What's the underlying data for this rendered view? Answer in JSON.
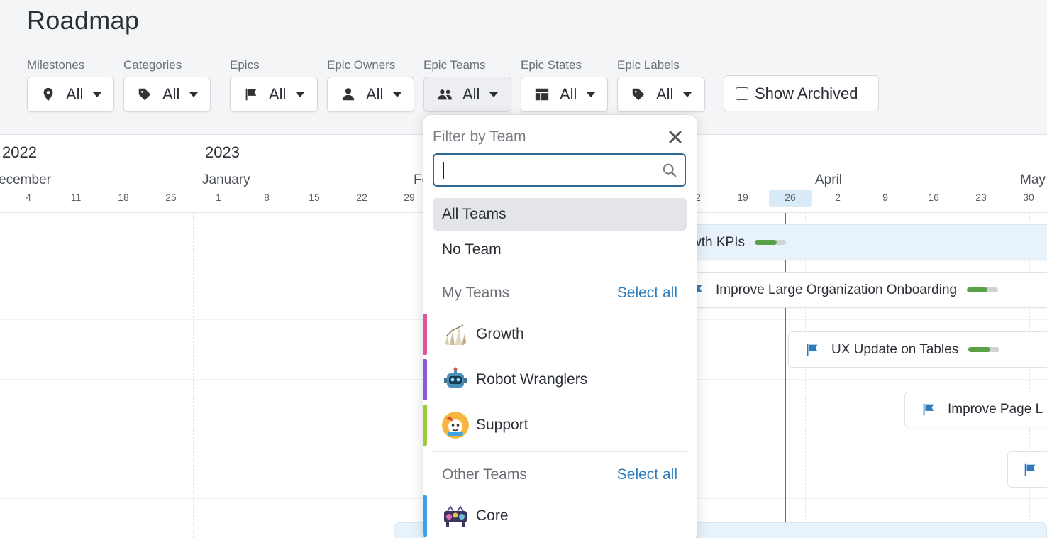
{
  "page": {
    "title": "Roadmap"
  },
  "filters": [
    {
      "label": "Milestones",
      "value": "All",
      "icon": "map-pin-icon"
    },
    {
      "label": "Categories",
      "value": "All",
      "icon": "tag-icon"
    },
    {
      "label": "Epics",
      "value": "All",
      "icon": "flag-icon"
    },
    {
      "label": "Epic Owners",
      "value": "All",
      "icon": "user-icon"
    },
    {
      "label": "Epic Teams",
      "value": "All",
      "icon": "users-icon"
    },
    {
      "label": "Epic States",
      "value": "All",
      "icon": "table-icon"
    },
    {
      "label": "Epic Labels",
      "value": "All",
      "icon": "tag-icon"
    }
  ],
  "show_archived": {
    "label": "Show Archived",
    "checked": false
  },
  "timeline": {
    "years": [
      "2022",
      "2023"
    ],
    "months": [
      "ecember",
      "January",
      "Fe",
      "April",
      "May"
    ],
    "weeks": [
      "4",
      "11",
      "18",
      "25",
      "1",
      "8",
      "15",
      "22",
      "29",
      "2",
      "19",
      "26",
      "2",
      "9",
      "16",
      "23",
      "30"
    ],
    "today_week": "26"
  },
  "epics": [
    {
      "name": "wth KPIs",
      "progress": 0.7
    },
    {
      "name": "Improve Large Organization Onboarding",
      "progress": 0.65
    },
    {
      "name": "UX Update on Tables",
      "progress": 0.7
    },
    {
      "name": "Improve Page L",
      "progress": null
    },
    {
      "name": "",
      "progress": null
    }
  ],
  "team_dropdown": {
    "title": "Filter by Team",
    "search_value": "",
    "options": [
      "All Teams",
      "No Team"
    ],
    "selected": "All Teams",
    "my_teams": {
      "label": "My Teams",
      "select_all": "Select all",
      "teams": [
        {
          "name": "Growth",
          "color": "#e0559a"
        },
        {
          "name": "Robot Wranglers",
          "color": "#8a5bd6"
        },
        {
          "name": "Support",
          "color": "#9ccc3a"
        }
      ]
    },
    "other_teams": {
      "label": "Other Teams",
      "select_all": "Select all",
      "teams": [
        {
          "name": "Core",
          "color": "#3aa3e3"
        }
      ]
    }
  },
  "colors": {
    "accent": "#2e7cbb",
    "progress": "#5aa046",
    "today": "#2e7cbb"
  }
}
